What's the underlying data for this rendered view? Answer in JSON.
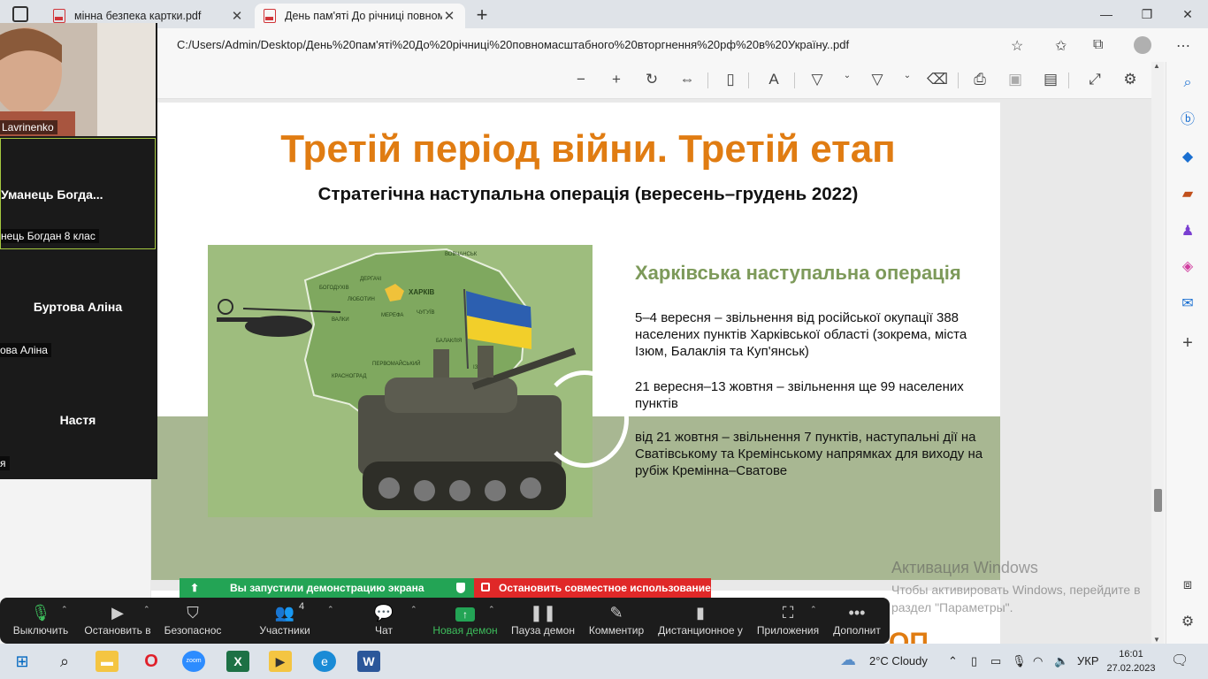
{
  "browser": {
    "tabs": [
      {
        "label": "мінна безпека картки.pdf",
        "active": false
      },
      {
        "label": "День пам'яті До річниці повном",
        "active": true
      }
    ],
    "address": "C:/Users/Admin/Desktop/День%20пам'яті%20До%20річниці%20повномасштабного%20вторгнення%20рф%20в%20Україну..pdf"
  },
  "slide": {
    "title": "Третій період війни. Третій етап",
    "subtitle": "Стратегічна наступальна операція (вересень–грудень 2022)",
    "operation_heading": "Харківська наступальна операція",
    "paragraphs": [
      "5–4 вересня – звільнення від російської окупації 388 населених пунктів Харківської області (зокрема, міста Ізюм, Балаклія та Куп'янськ)",
      "21 вересня–13 жовтня – звільнення ще 99 населених пунктів",
      "від 21 жовтня – звільнення 7 пунктів, наступальні дії на Сватівському та Кремінському напрямках для виходу на рубіж Кремінна–Сватове"
    ],
    "map_labels": [
      "ХАРКІВ",
      "БОГОДУХІВ",
      "ДЕРГАЧІ",
      "ЛЮБОТИН",
      "ВАЛКИ",
      "ВОВЧАНСЬК",
      "ЧУГУЇВ",
      "МЕРЕФА",
      "БАЛАКЛІЯ",
      "ІЗЮМ",
      "ПЕРВОМАЙСЬКИЙ",
      "КРАСНОГРАД"
    ],
    "next_page_text": "ОП"
  },
  "watermark": {
    "line1": "Активация Windows",
    "line2": "Чтобы активировать Windows, перейдите в раздел \"Параметры\"."
  },
  "zoom": {
    "self_name": "Lavrinenko",
    "participants": [
      {
        "big": "Уманець  Богда...",
        "small": "нець Богдан 8 клас"
      },
      {
        "big": "Буртова Аліна",
        "small": "ова Аліна"
      },
      {
        "big": "Настя",
        "small": "я"
      }
    ],
    "share_banner": "Вы запустили демонстрацию экрана",
    "stop_share": "Остановить совместное использование",
    "controls": {
      "mute": "Выключить",
      "video": "Остановить в",
      "security": "Безопаснос",
      "participants": "Участники",
      "participants_count": "4",
      "chat": "Чат",
      "new_share": "Новая демон",
      "pause_share": "Пауза демон",
      "annotate": "Комментир",
      "remote": "Дистанционное у",
      "apps": "Приложения",
      "more": "Дополнит"
    }
  },
  "taskbar": {
    "weather": "2°C  Cloudy",
    "lang": "УКР",
    "time": "16:01",
    "date": "27.02.2023"
  },
  "colors": {
    "title_orange": "#e07c12",
    "heading_green": "#7d9a5a",
    "band_green": "#a8b792",
    "zoom_green": "#23a455",
    "zoom_red": "#e02828"
  }
}
